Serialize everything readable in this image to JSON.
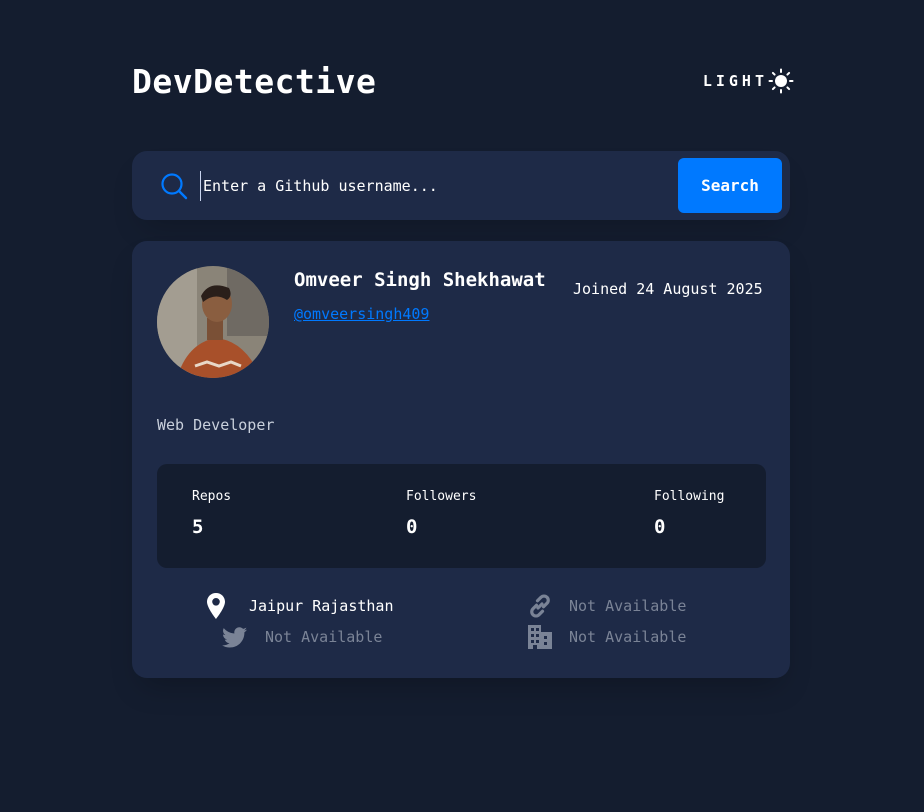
{
  "app": {
    "title": "DevDetective",
    "theme_toggle_label": "LIGHT",
    "theme_icon": "sun-icon"
  },
  "search": {
    "placeholder": "Enter a Github username...",
    "value": "",
    "button_label": "Search",
    "icon": "search-icon"
  },
  "profile": {
    "avatar_icon": "avatar",
    "name": "Omveer Singh Shekhawat",
    "joined": "Joined 24 August 2025",
    "handle": "@omveersingh409",
    "bio": "Web Developer",
    "stats": {
      "repos_label": "Repos",
      "repos_value": "5",
      "followers_label": "Followers",
      "followers_value": "0",
      "following_label": "Following",
      "following_value": "0"
    },
    "links": {
      "location": "Jaipur Rajasthan",
      "twitter": "Not Available",
      "blog": "Not Available",
      "company": "Not Available"
    }
  },
  "colors": {
    "background": "#141d2f",
    "card": "#1e2a47",
    "accent": "#0079ff",
    "muted": "#7a8396"
  }
}
